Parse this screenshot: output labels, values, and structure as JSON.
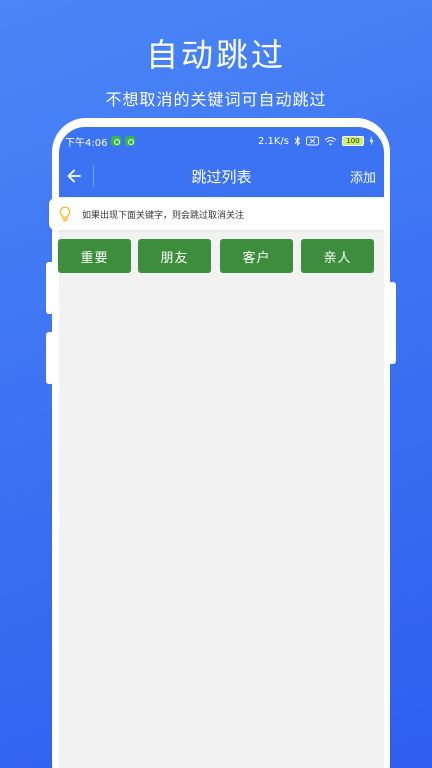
{
  "promo": {
    "title": "自动跳过",
    "subtitle": "不想取消的关键词可自动跳过"
  },
  "status_bar": {
    "time": "下午4:06",
    "network_speed": "2.1K/s",
    "battery": "100"
  },
  "toolbar": {
    "title": "跳过列表",
    "add_label": "添加"
  },
  "tip": {
    "text": "如果出现下面关键字，则会跳过取消关注"
  },
  "keywords": [
    {
      "label": "重要"
    },
    {
      "label": "朋友"
    },
    {
      "label": "客户"
    },
    {
      "label": "亲人"
    }
  ],
  "colors": {
    "background": "#3b6ff2",
    "appbar": "#3b73f2",
    "keyword_button": "#3c8e3d",
    "tip_icon": "#f2b51b"
  }
}
